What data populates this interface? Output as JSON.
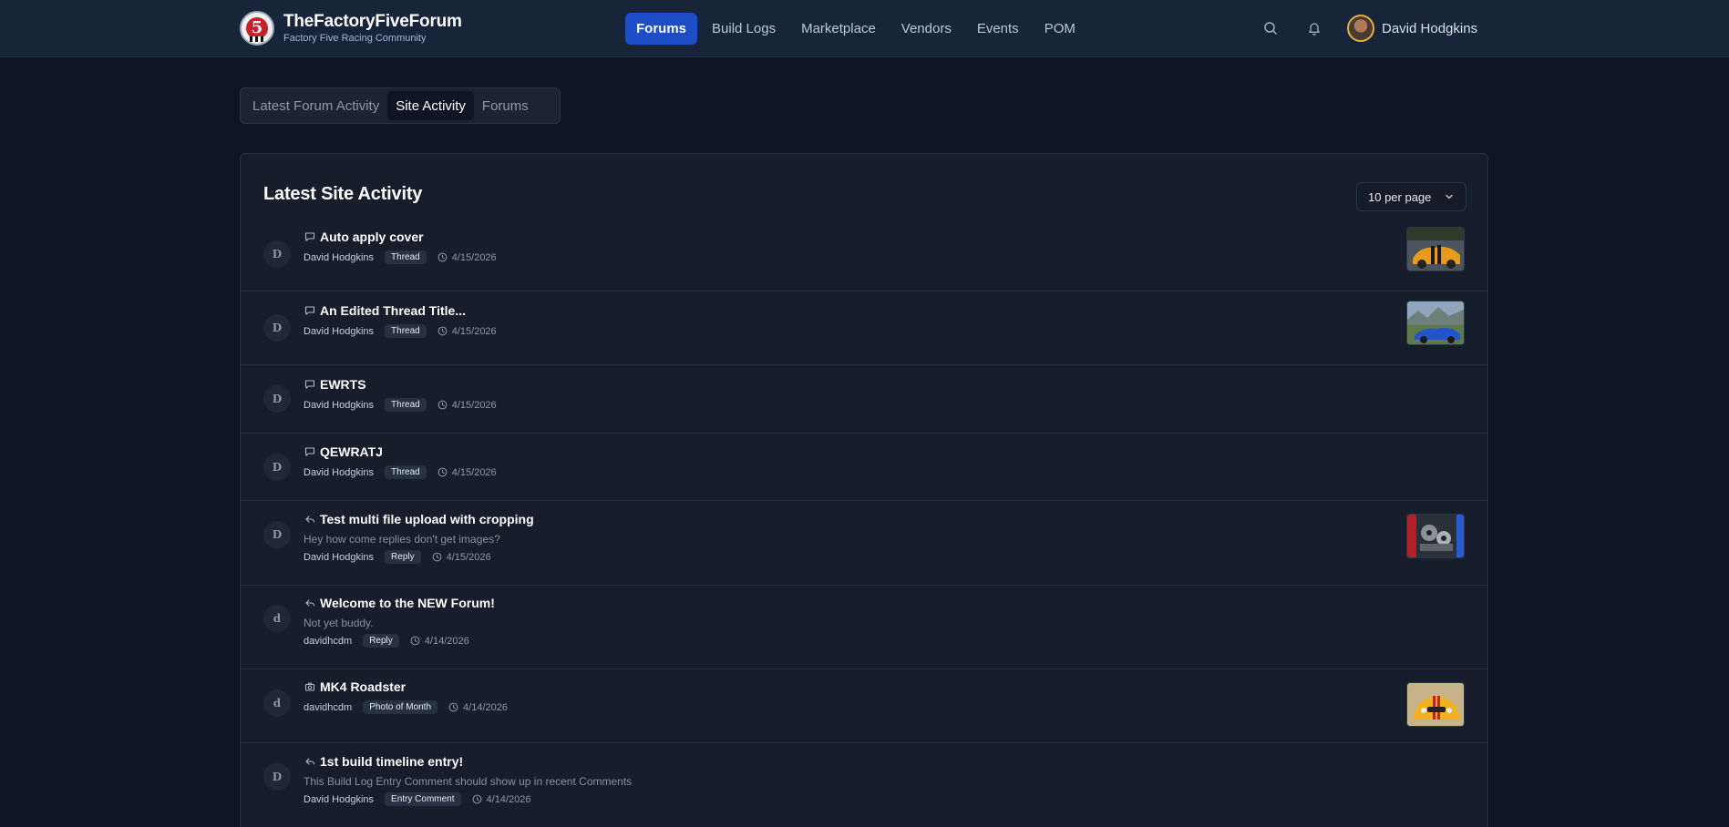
{
  "header": {
    "brand_title": "TheFactoryFiveForum",
    "brand_subtitle": "Factory Five Racing Community",
    "logo_icon": "factory-five-logo",
    "nav": [
      {
        "label": "Forums",
        "active": true
      },
      {
        "label": "Build Logs",
        "active": false
      },
      {
        "label": "Marketplace",
        "active": false
      },
      {
        "label": "Vendors",
        "active": false
      },
      {
        "label": "Events",
        "active": false
      },
      {
        "label": "POM",
        "active": false
      }
    ],
    "search_icon": "search-icon",
    "notifications_icon": "bell-icon",
    "user_name": "David Hodgkins"
  },
  "tabs": [
    {
      "label": "Latest Forum Activity",
      "active": false
    },
    {
      "label": "Site Activity",
      "active": true
    },
    {
      "label": "Forums",
      "active": false
    }
  ],
  "activity": {
    "title": "Latest Site Activity",
    "per_page": "10 per page",
    "items": [
      {
        "initial": "D",
        "icon": "message-icon",
        "title": "Auto apply cover",
        "author": "David Hodgkins",
        "badge": "Thread",
        "date": "4/15/2026",
        "thumbnail": "orange-cobra-photo"
      },
      {
        "initial": "D",
        "icon": "message-icon",
        "title": "An Edited Thread Title...",
        "author": "David Hodgkins",
        "badge": "Thread",
        "date": "4/15/2026",
        "thumbnail": "blue-cobra-photo"
      },
      {
        "initial": "D",
        "icon": "message-icon",
        "title": "EWRTS",
        "author": "David Hodgkins",
        "badge": "Thread",
        "date": "4/15/2026"
      },
      {
        "initial": "D",
        "icon": "message-icon",
        "title": "QEWRATJ",
        "author": "David Hodgkins",
        "badge": "Thread",
        "date": "4/15/2026"
      },
      {
        "initial": "D",
        "icon": "reply-icon",
        "title": "Test multi file upload with cropping",
        "snippet": "Hey how come replies don't get images?",
        "author": "David Hodgkins",
        "badge": "Reply",
        "date": "4/15/2026",
        "thumbnail": "engine-bay-photo"
      },
      {
        "initial": "d",
        "icon": "reply-icon",
        "title": "Welcome to the NEW Forum!",
        "snippet": "Not yet buddy.",
        "author": "davidhcdm",
        "badge": "Reply",
        "date": "4/14/2026"
      },
      {
        "initial": "d",
        "icon": "camera-icon",
        "title": "MK4 Roadster",
        "author": "davidhcdm",
        "badge": "Photo of Month",
        "date": "4/14/2026",
        "thumbnail": "yellow-roadster-photo"
      },
      {
        "initial": "D",
        "icon": "reply-icon",
        "title": "1st build timeline entry!",
        "snippet": "This Build Log Entry Comment should show up in recent Comments",
        "author": "David Hodgkins",
        "badge": "Entry Comment",
        "date": "4/14/2026"
      }
    ]
  },
  "colors": {
    "page_bg": "#0f1623",
    "header_bg": "#172439",
    "card_bg": "#161e2b",
    "accent": "#1d4ec7",
    "avatar_ring": "#e0b33a"
  }
}
